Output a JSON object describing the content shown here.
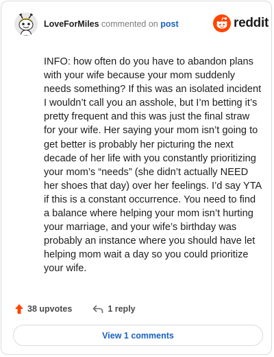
{
  "comment": {
    "username": "LoveForMiles",
    "action_text": " commented on ",
    "post_link": "post",
    "body": "INFO: how often do you have to abandon plans with your wife because your mom suddenly needs something? If this was an isolated incident I wouldn’t call you an asshole, but I’m betting it’s pretty frequent and this was just the final straw for your wife. Her saying your mom isn’t going to get better is probably her picturing the next decade of her life with you constantly prioritizing your mom’s “needs” (she didn’t actually NEED her shoes that day) over her feelings. I’d say YTA if this is a constant occurrence. You need to find a balance where helping your mom isn’t hurting your marriage, and your wife’s birthday was probably an instance where you should have let helping mom wait a day so you could prioritize your wife."
  },
  "brand": {
    "logo_text": "reddit"
  },
  "stats": {
    "upvotes": "38 upvotes",
    "replies": "1 reply"
  },
  "actions": {
    "view_comments": "View 1 comments"
  },
  "colors": {
    "brand": "#ff4500",
    "upvote": "#ff4500",
    "link": "#1560c2",
    "text": "#1c1c1c"
  },
  "icons": {
    "avatar": "snoo-avatar-icon",
    "logo": "reddit-logo-icon",
    "upvote": "upvote-arrow-icon",
    "reply": "reply-arrow-icon"
  }
}
